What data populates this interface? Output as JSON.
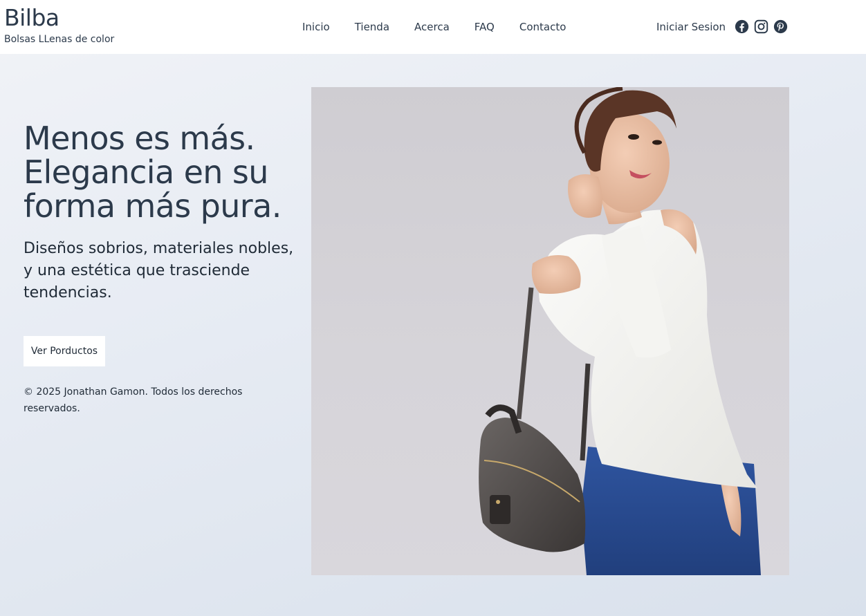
{
  "brand": {
    "name": "Bilba",
    "tagline": "Bolsas LLenas de color"
  },
  "nav": {
    "items": [
      {
        "label": "Inicio"
      },
      {
        "label": "Tienda"
      },
      {
        "label": "Acerca"
      },
      {
        "label": "FAQ"
      },
      {
        "label": "Contacto"
      }
    ],
    "login_label": "Iniciar Sesion",
    "socials": [
      "facebook-icon",
      "instagram-icon",
      "pinterest-icon"
    ]
  },
  "hero": {
    "title": "Menos es más. Elegancia en su forma más pura.",
    "subtitle": "Diseños sobrios, materiales nobles, y una estética que trasciende tendencias.",
    "cta_label": "Ver Porductos",
    "copyright": "© 2025 Jonathan Gamon. Todos los derechos reservados."
  },
  "colors": {
    "text": "#2c3a4b",
    "header_bg": "#ffffff",
    "page_bg": "#e6ebf3"
  }
}
